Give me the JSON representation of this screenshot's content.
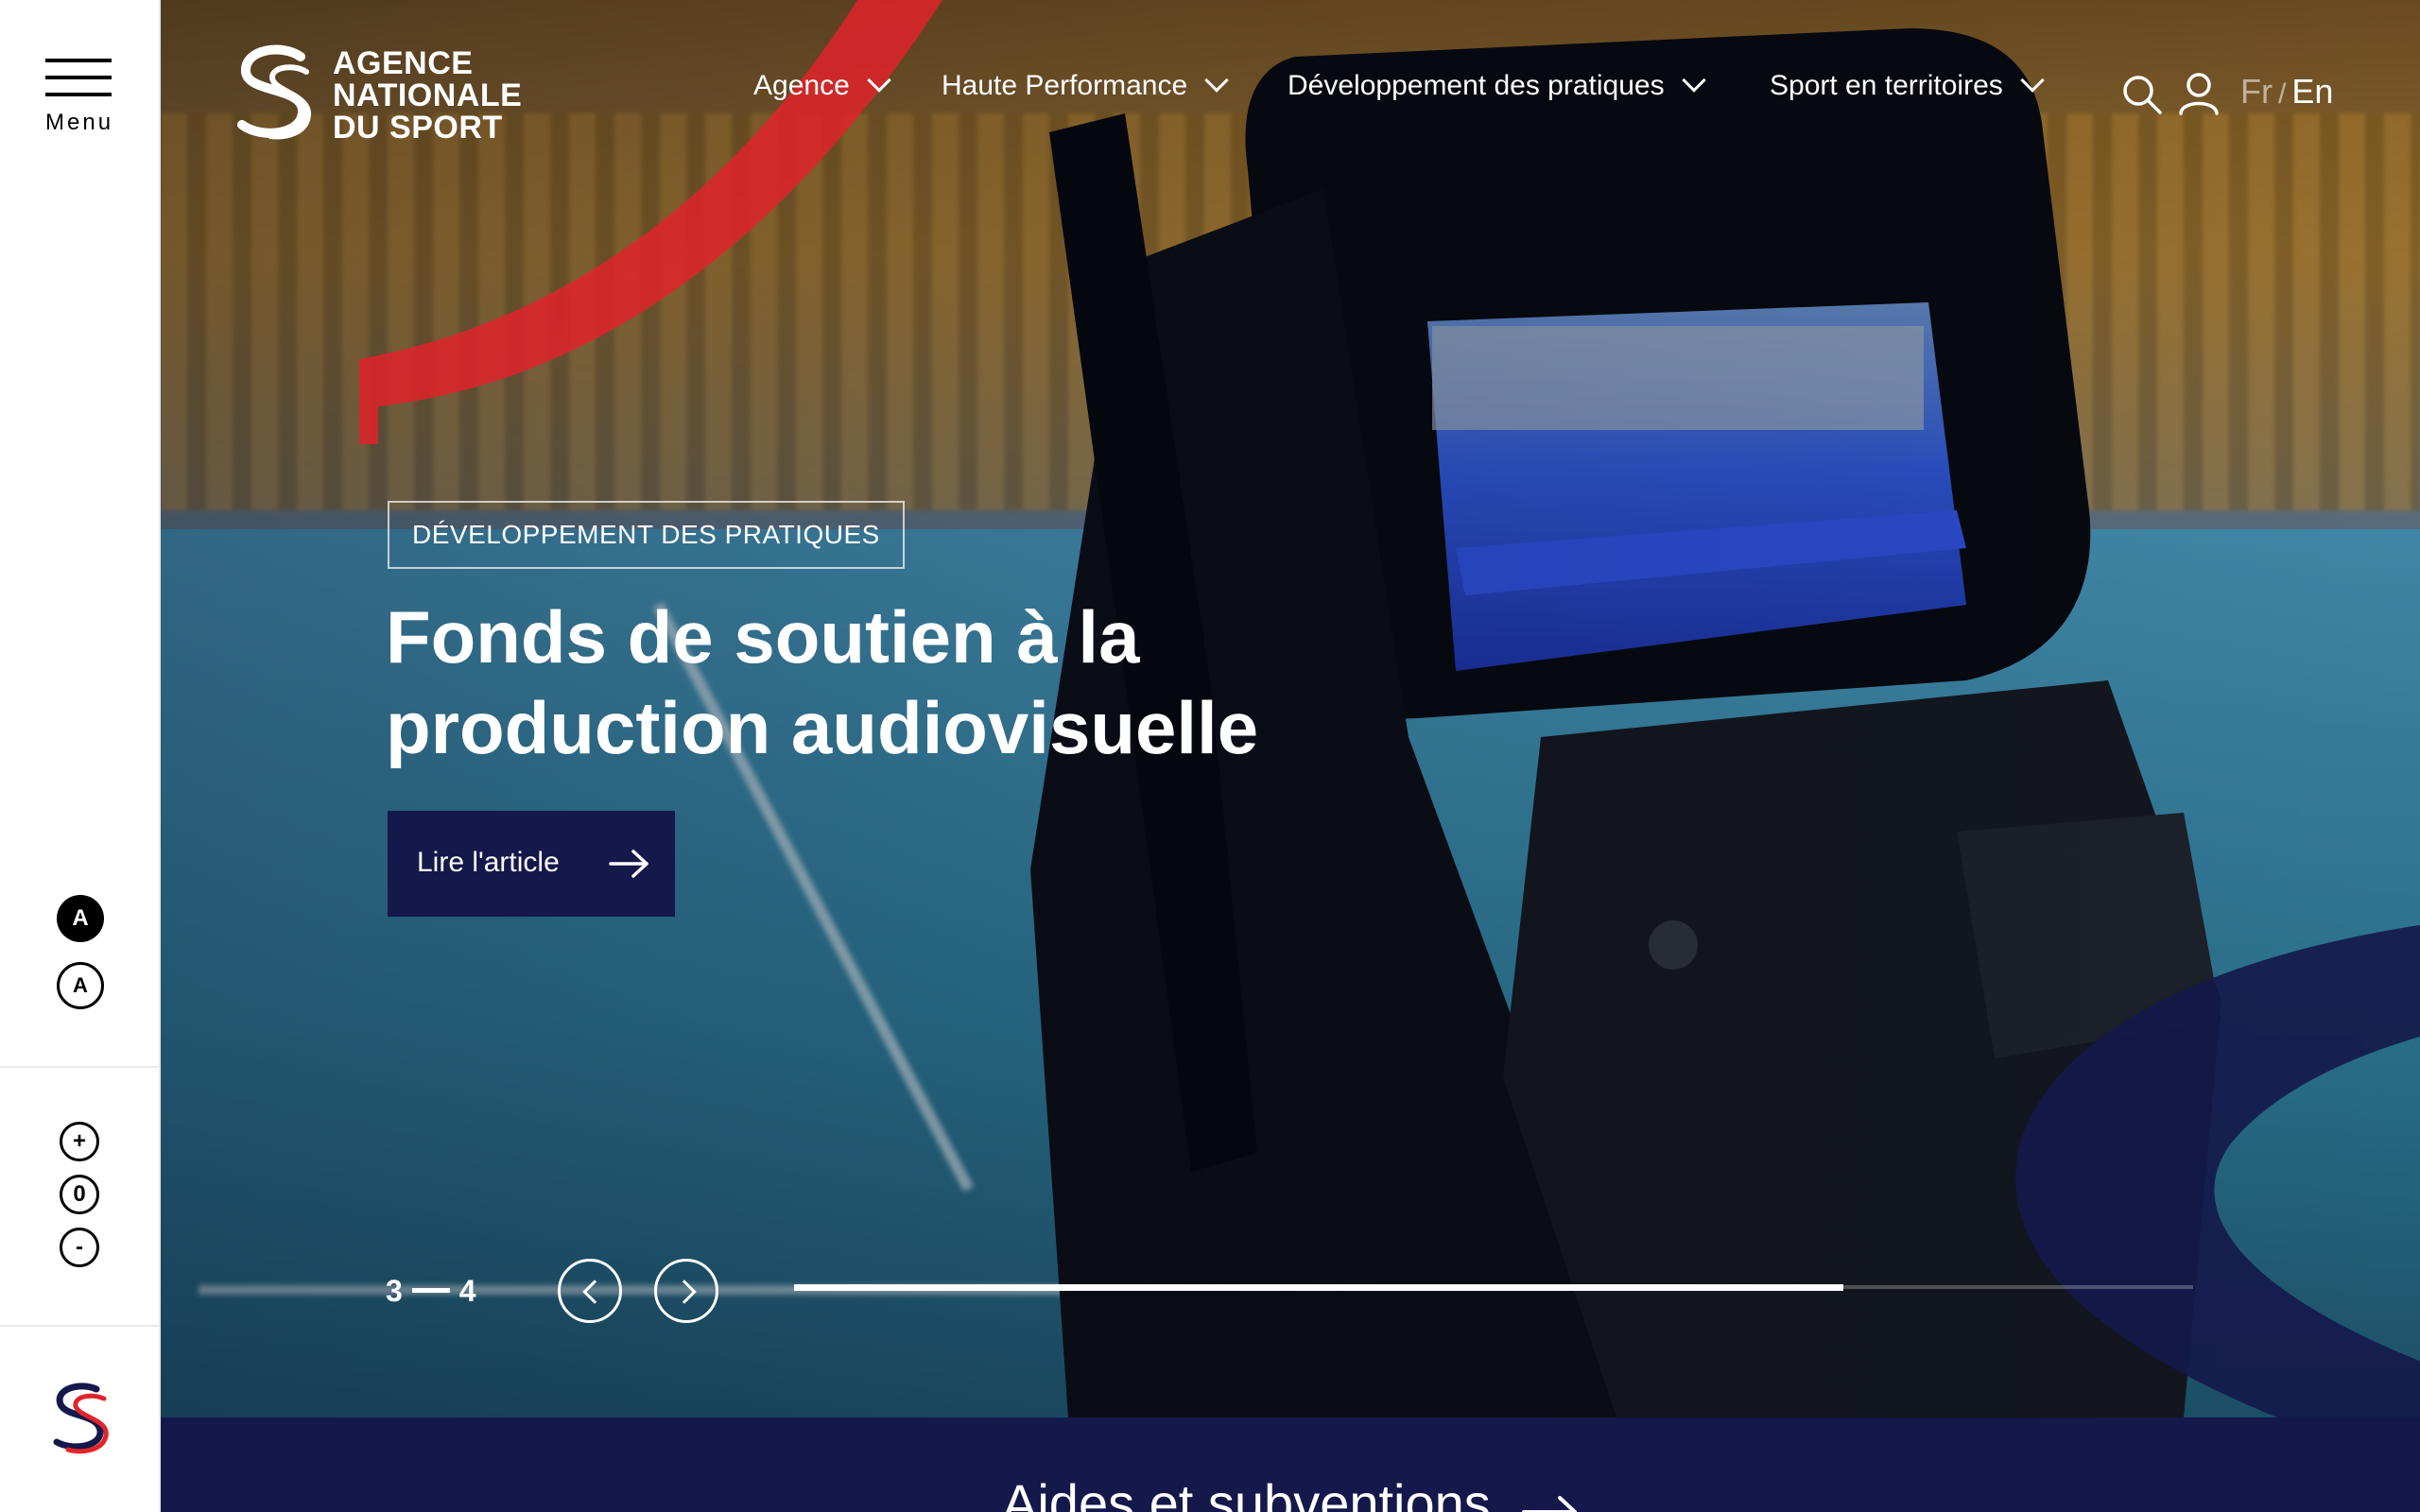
{
  "rail": {
    "menu_label": "Menu",
    "contrast_dark_label": "A",
    "contrast_light_label": "A",
    "font_increase": "+",
    "font_reset": "0",
    "font_decrease": "-"
  },
  "header": {
    "logo_lines": [
      "AGENCE",
      "NATIONALE",
      "DU SPORT"
    ],
    "nav": [
      {
        "label": "Agence"
      },
      {
        "label": "Haute Performance"
      },
      {
        "label": "Développement des pratiques"
      },
      {
        "label": "Sport en territoires"
      }
    ],
    "lang_fr": "Fr",
    "lang_sep": "/",
    "lang_en": "En"
  },
  "slide": {
    "tag": "DÉVELOPPEMENT DES PRATIQUES",
    "title_line1": "Fonds de soutien à la",
    "title_line2": "production audiovisuelle",
    "cta": "Lire l'article",
    "current": "3",
    "total": "4",
    "progress": 0.75
  },
  "band": {
    "title": "Aides et subventions"
  },
  "colors": {
    "navy": "#14184a",
    "red": "#e1232a",
    "white": "#ffffff"
  },
  "icons": [
    "hamburger-icon",
    "search-icon",
    "user-icon",
    "chevron-down-icon",
    "arrow-right-icon",
    "chevron-left-icon",
    "chevron-right-icon"
  ]
}
